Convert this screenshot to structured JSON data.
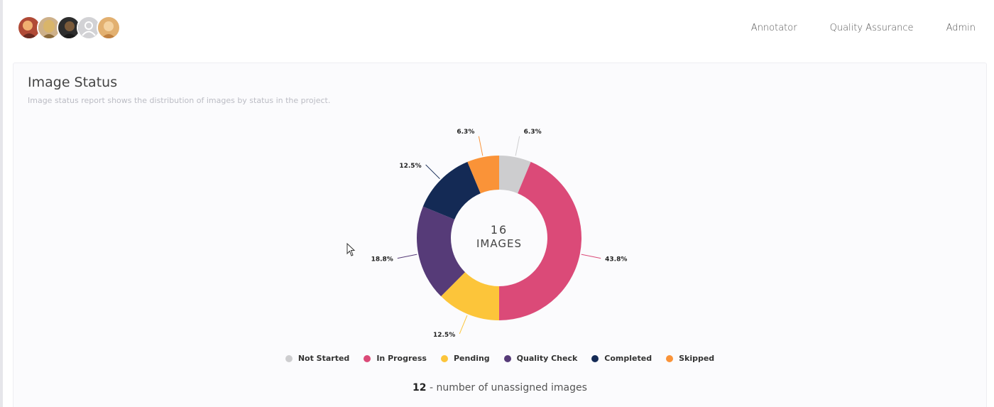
{
  "header": {
    "avatars": [
      {
        "icon": "user-avatar-icon",
        "bg": "#c9553a"
      },
      {
        "icon": "user-avatar-icon",
        "bg": "#c9a77a"
      },
      {
        "icon": "user-avatar-icon",
        "bg": "#3a3a3a"
      },
      {
        "icon": "default-user-avatar-icon",
        "bg": "#cfcfd2"
      },
      {
        "icon": "user-avatar-icon",
        "bg": "#d9a060"
      }
    ],
    "nav": [
      "Annotator",
      "Quality Assurance",
      "Admin"
    ]
  },
  "card": {
    "title": "Image Status",
    "subtitle": "Image status report shows the distribution of images by status in the project."
  },
  "chart_data": {
    "type": "pie",
    "variant": "donut",
    "center_value": "16",
    "center_label": "IMAGES",
    "categories": [
      "Not Started",
      "In Progress",
      "Pending",
      "Quality Check",
      "Completed",
      "Skipped"
    ],
    "values": [
      6.3,
      43.8,
      12.5,
      18.8,
      12.5,
      6.3
    ],
    "labels": [
      "6.3%",
      "43.8%",
      "12.5%",
      "18.8%",
      "12.5%",
      "6.3%"
    ],
    "colors": [
      "#cdcdcf",
      "#db4a78",
      "#fcc53a",
      "#563b78",
      "#142a55",
      "#fa9338"
    ],
    "legend_position": "bottom"
  },
  "footer": {
    "unassigned_count": "12",
    "unassigned_text": " - number of unassigned images"
  }
}
